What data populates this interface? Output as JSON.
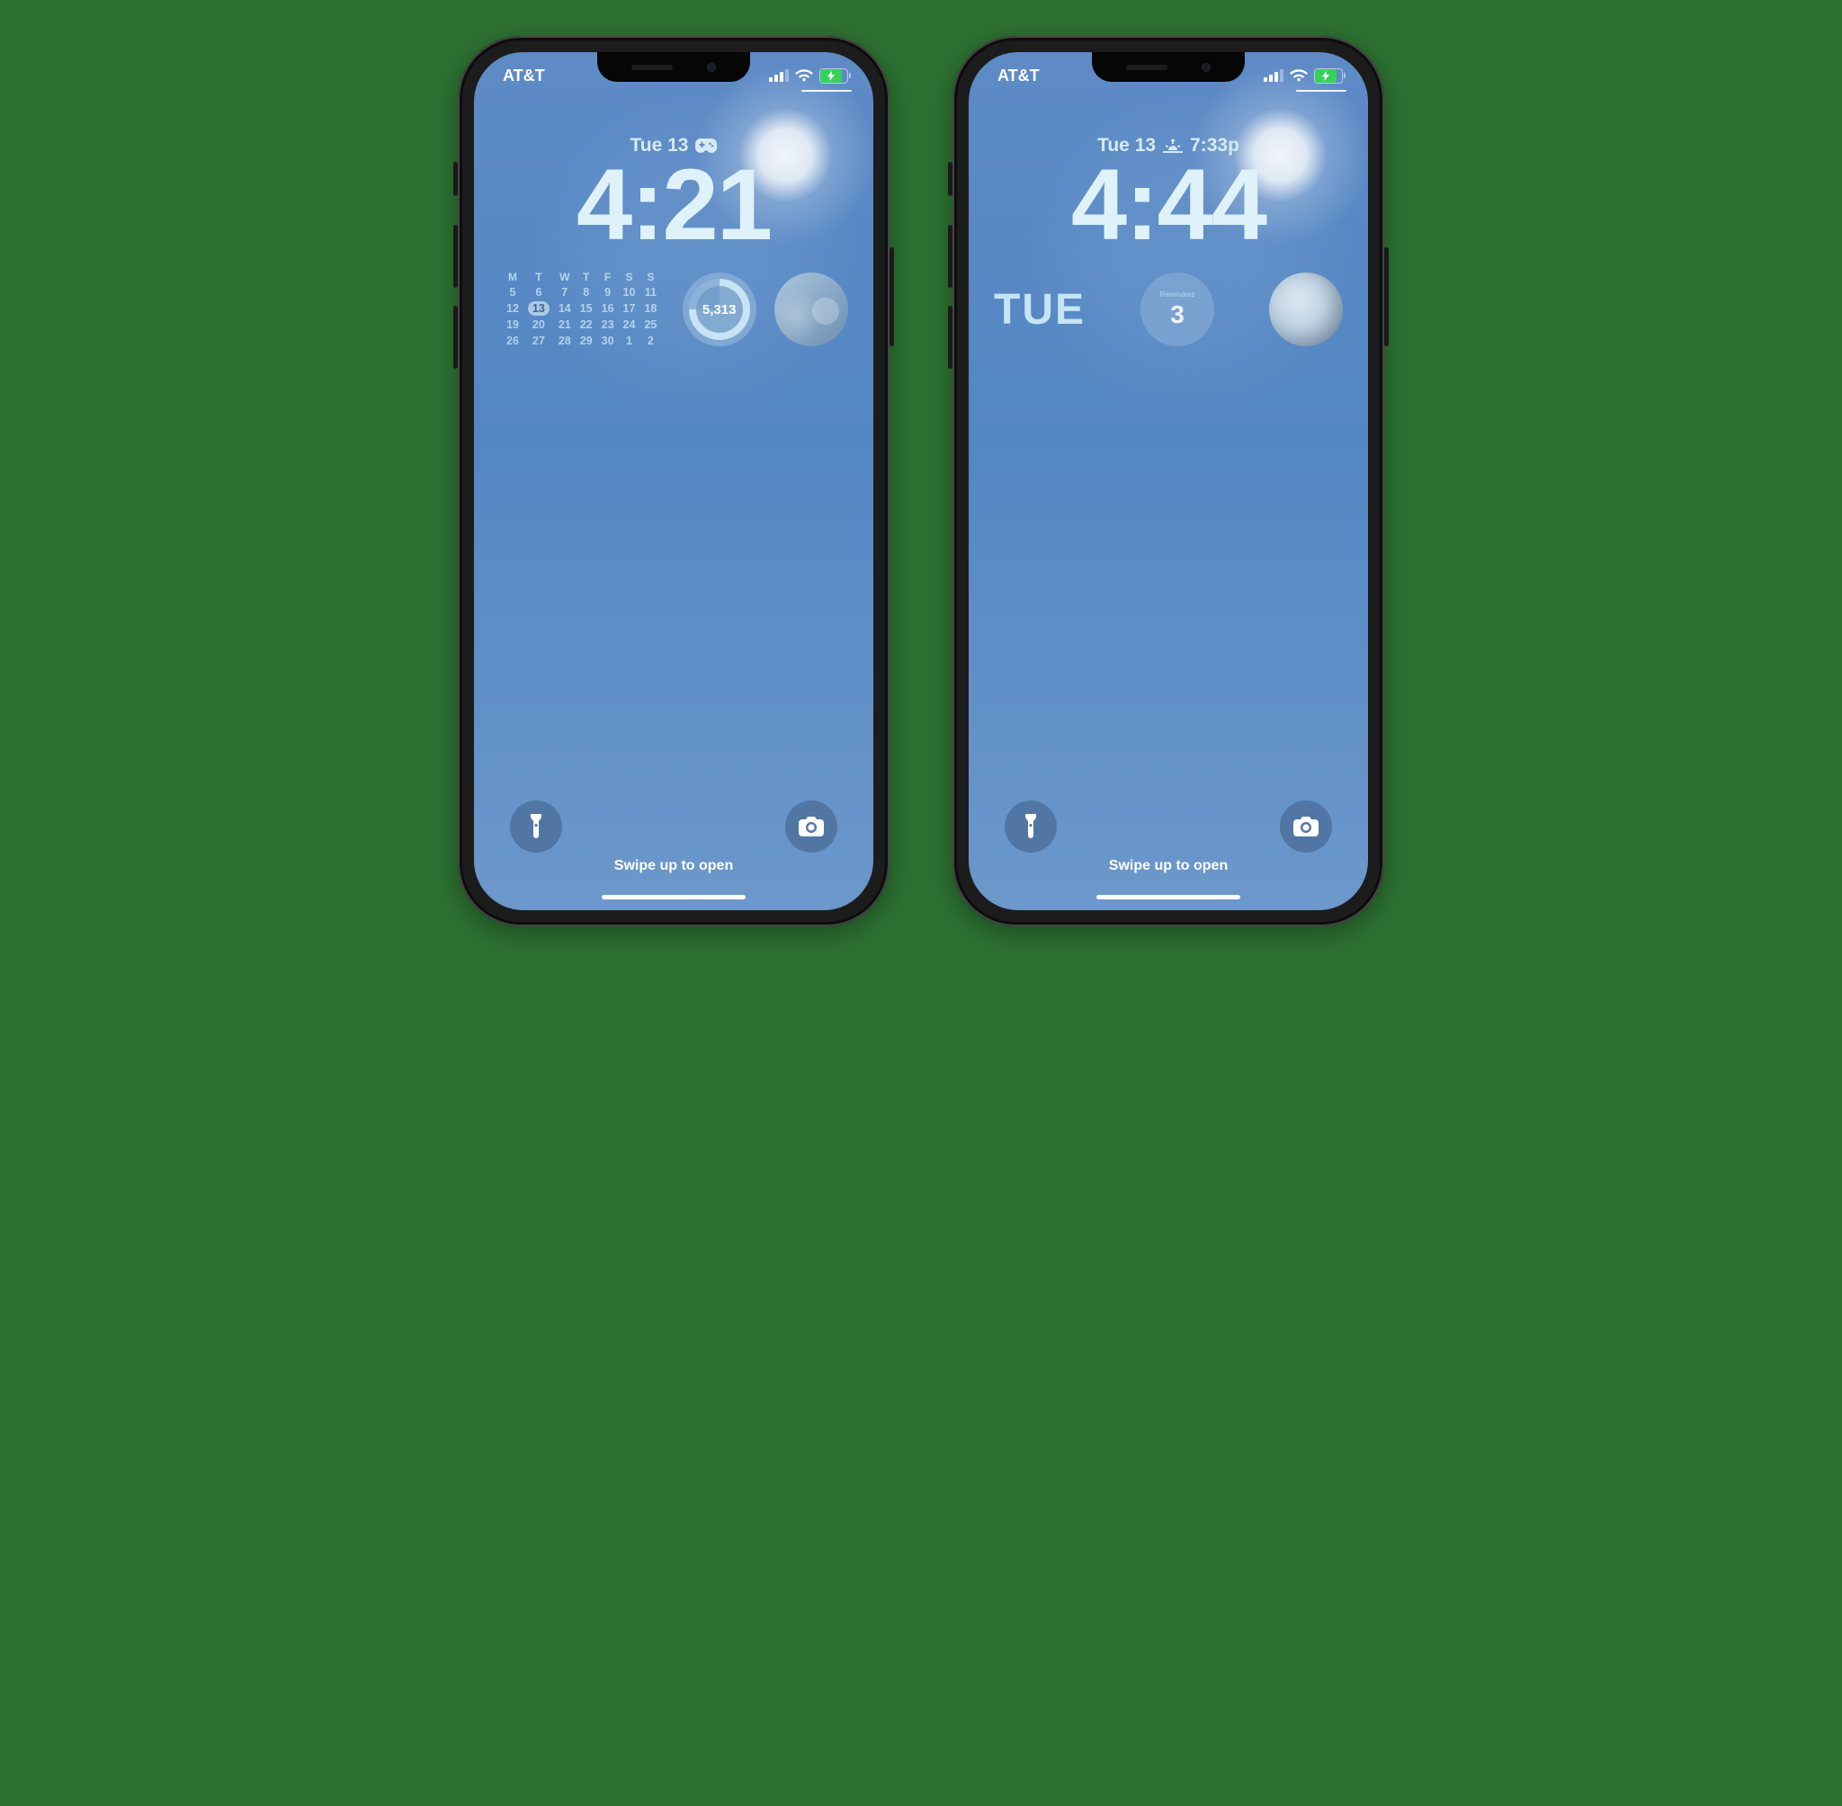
{
  "phones": [
    {
      "status": {
        "carrier": "AT&T"
      },
      "dateline": {
        "text": "Tue 13",
        "icon": "game-controller"
      },
      "time": "4:21",
      "widgets": {
        "type": "calendar-ring-photo",
        "calendar": {
          "headers": [
            "M",
            "T",
            "W",
            "T",
            "F",
            "S",
            "S"
          ],
          "rows": [
            [
              "5",
              "6",
              "7",
              "8",
              "9",
              "10",
              "11"
            ],
            [
              "12",
              "13",
              "14",
              "15",
              "16",
              "17",
              "18"
            ],
            [
              "19",
              "20",
              "21",
              "22",
              "23",
              "24",
              "25"
            ],
            [
              "26",
              "27",
              "28",
              "29",
              "30",
              "1",
              "2"
            ]
          ],
          "today": "13"
        },
        "ring_value": "5,313"
      },
      "hint": "Swipe up to open"
    },
    {
      "status": {
        "carrier": "AT&T"
      },
      "dateline": {
        "text": "Tue 13",
        "icon": "sunset",
        "extra": "7:33p"
      },
      "time": "4:44",
      "widgets": {
        "type": "day-card-moon",
        "dayname": "TUE",
        "card_number": "3"
      },
      "hint": "Swipe up to open"
    }
  ]
}
